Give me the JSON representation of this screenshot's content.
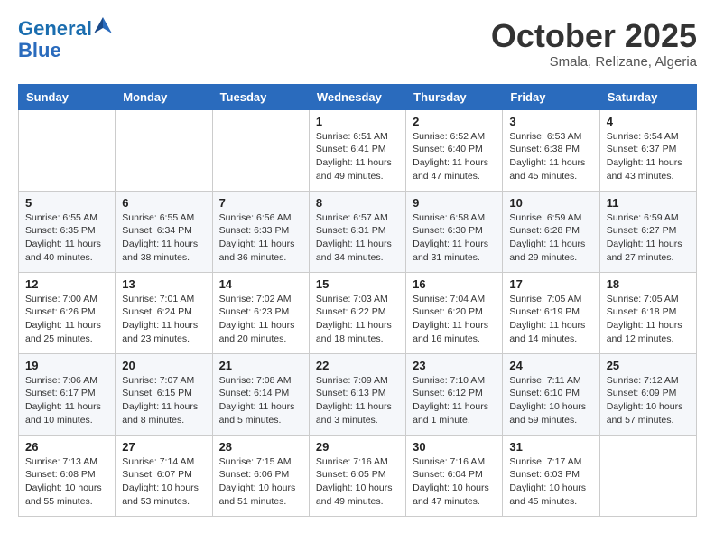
{
  "header": {
    "logo_line1": "General",
    "logo_line2": "Blue",
    "month": "October 2025",
    "location": "Smala, Relizane, Algeria"
  },
  "weekdays": [
    "Sunday",
    "Monday",
    "Tuesday",
    "Wednesday",
    "Thursday",
    "Friday",
    "Saturday"
  ],
  "weeks": [
    [
      {
        "day": "",
        "info": ""
      },
      {
        "day": "",
        "info": ""
      },
      {
        "day": "",
        "info": ""
      },
      {
        "day": "1",
        "info": "Sunrise: 6:51 AM\nSunset: 6:41 PM\nDaylight: 11 hours and 49 minutes."
      },
      {
        "day": "2",
        "info": "Sunrise: 6:52 AM\nSunset: 6:40 PM\nDaylight: 11 hours and 47 minutes."
      },
      {
        "day": "3",
        "info": "Sunrise: 6:53 AM\nSunset: 6:38 PM\nDaylight: 11 hours and 45 minutes."
      },
      {
        "day": "4",
        "info": "Sunrise: 6:54 AM\nSunset: 6:37 PM\nDaylight: 11 hours and 43 minutes."
      }
    ],
    [
      {
        "day": "5",
        "info": "Sunrise: 6:55 AM\nSunset: 6:35 PM\nDaylight: 11 hours and 40 minutes."
      },
      {
        "day": "6",
        "info": "Sunrise: 6:55 AM\nSunset: 6:34 PM\nDaylight: 11 hours and 38 minutes."
      },
      {
        "day": "7",
        "info": "Sunrise: 6:56 AM\nSunset: 6:33 PM\nDaylight: 11 hours and 36 minutes."
      },
      {
        "day": "8",
        "info": "Sunrise: 6:57 AM\nSunset: 6:31 PM\nDaylight: 11 hours and 34 minutes."
      },
      {
        "day": "9",
        "info": "Sunrise: 6:58 AM\nSunset: 6:30 PM\nDaylight: 11 hours and 31 minutes."
      },
      {
        "day": "10",
        "info": "Sunrise: 6:59 AM\nSunset: 6:28 PM\nDaylight: 11 hours and 29 minutes."
      },
      {
        "day": "11",
        "info": "Sunrise: 6:59 AM\nSunset: 6:27 PM\nDaylight: 11 hours and 27 minutes."
      }
    ],
    [
      {
        "day": "12",
        "info": "Sunrise: 7:00 AM\nSunset: 6:26 PM\nDaylight: 11 hours and 25 minutes."
      },
      {
        "day": "13",
        "info": "Sunrise: 7:01 AM\nSunset: 6:24 PM\nDaylight: 11 hours and 23 minutes."
      },
      {
        "day": "14",
        "info": "Sunrise: 7:02 AM\nSunset: 6:23 PM\nDaylight: 11 hours and 20 minutes."
      },
      {
        "day": "15",
        "info": "Sunrise: 7:03 AM\nSunset: 6:22 PM\nDaylight: 11 hours and 18 minutes."
      },
      {
        "day": "16",
        "info": "Sunrise: 7:04 AM\nSunset: 6:20 PM\nDaylight: 11 hours and 16 minutes."
      },
      {
        "day": "17",
        "info": "Sunrise: 7:05 AM\nSunset: 6:19 PM\nDaylight: 11 hours and 14 minutes."
      },
      {
        "day": "18",
        "info": "Sunrise: 7:05 AM\nSunset: 6:18 PM\nDaylight: 11 hours and 12 minutes."
      }
    ],
    [
      {
        "day": "19",
        "info": "Sunrise: 7:06 AM\nSunset: 6:17 PM\nDaylight: 11 hours and 10 minutes."
      },
      {
        "day": "20",
        "info": "Sunrise: 7:07 AM\nSunset: 6:15 PM\nDaylight: 11 hours and 8 minutes."
      },
      {
        "day": "21",
        "info": "Sunrise: 7:08 AM\nSunset: 6:14 PM\nDaylight: 11 hours and 5 minutes."
      },
      {
        "day": "22",
        "info": "Sunrise: 7:09 AM\nSunset: 6:13 PM\nDaylight: 11 hours and 3 minutes."
      },
      {
        "day": "23",
        "info": "Sunrise: 7:10 AM\nSunset: 6:12 PM\nDaylight: 11 hours and 1 minute."
      },
      {
        "day": "24",
        "info": "Sunrise: 7:11 AM\nSunset: 6:10 PM\nDaylight: 10 hours and 59 minutes."
      },
      {
        "day": "25",
        "info": "Sunrise: 7:12 AM\nSunset: 6:09 PM\nDaylight: 10 hours and 57 minutes."
      }
    ],
    [
      {
        "day": "26",
        "info": "Sunrise: 7:13 AM\nSunset: 6:08 PM\nDaylight: 10 hours and 55 minutes."
      },
      {
        "day": "27",
        "info": "Sunrise: 7:14 AM\nSunset: 6:07 PM\nDaylight: 10 hours and 53 minutes."
      },
      {
        "day": "28",
        "info": "Sunrise: 7:15 AM\nSunset: 6:06 PM\nDaylight: 10 hours and 51 minutes."
      },
      {
        "day": "29",
        "info": "Sunrise: 7:16 AM\nSunset: 6:05 PM\nDaylight: 10 hours and 49 minutes."
      },
      {
        "day": "30",
        "info": "Sunrise: 7:16 AM\nSunset: 6:04 PM\nDaylight: 10 hours and 47 minutes."
      },
      {
        "day": "31",
        "info": "Sunrise: 7:17 AM\nSunset: 6:03 PM\nDaylight: 10 hours and 45 minutes."
      },
      {
        "day": "",
        "info": ""
      }
    ]
  ]
}
